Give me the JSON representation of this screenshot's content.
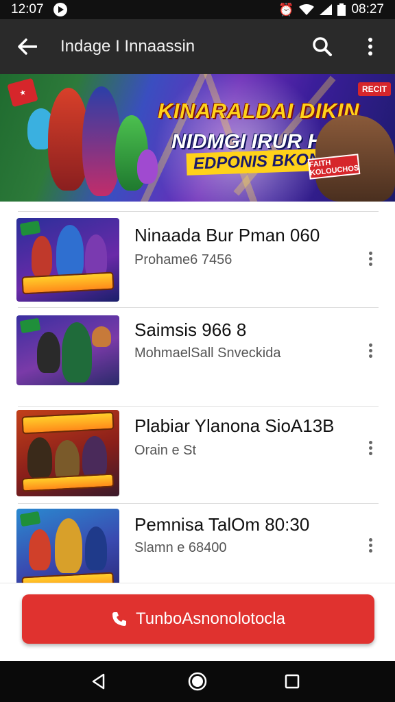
{
  "status_bar": {
    "time_left": "12:07",
    "time_right": "08:27",
    "icons": [
      "play-icon",
      "alarm-icon",
      "wifi-icon",
      "signal-icon",
      "battery-icon"
    ]
  },
  "app_bar": {
    "title": "Indage I Innaassin",
    "icons": [
      "back-arrow-icon",
      "search-icon",
      "more-vert-icon"
    ]
  },
  "banner": {
    "line1": "KINARALDAI DIKIN",
    "line2": "NIDMGI IRUR HINI",
    "line3": "EDPONIS BKONS",
    "badge_right": "RECIT",
    "wolf_badge": "FAITH KOLOUCHOS"
  },
  "list": {
    "items": [
      {
        "title": "Ninaada Bur Pman 060",
        "subtitle": "Prohame6 7456",
        "logo_text": "ONIMMAN"
      },
      {
        "title": "Saimsis 966 8",
        "subtitle": "MohmaelSall Snveckida",
        "logo_text": ""
      },
      {
        "title": "Plabiar Ylanona SioA13B",
        "subtitle": "Orain e St",
        "logo_text": "NINAAKES"
      },
      {
        "title": "Pemnisa TalOm 80:30",
        "subtitle": "Slamn e 68400",
        "logo_text": "RAUDOS"
      }
    ]
  },
  "cta": {
    "label": "TunboAsnonolotocla",
    "icon": "phone-icon",
    "color": "#e0322f"
  },
  "nav_bar": {
    "icons": [
      "back-triangle-icon",
      "home-circle-icon",
      "recents-square-icon"
    ]
  },
  "colors": {
    "app_bar": "#2a2a2a",
    "accent": "#e0322f"
  }
}
